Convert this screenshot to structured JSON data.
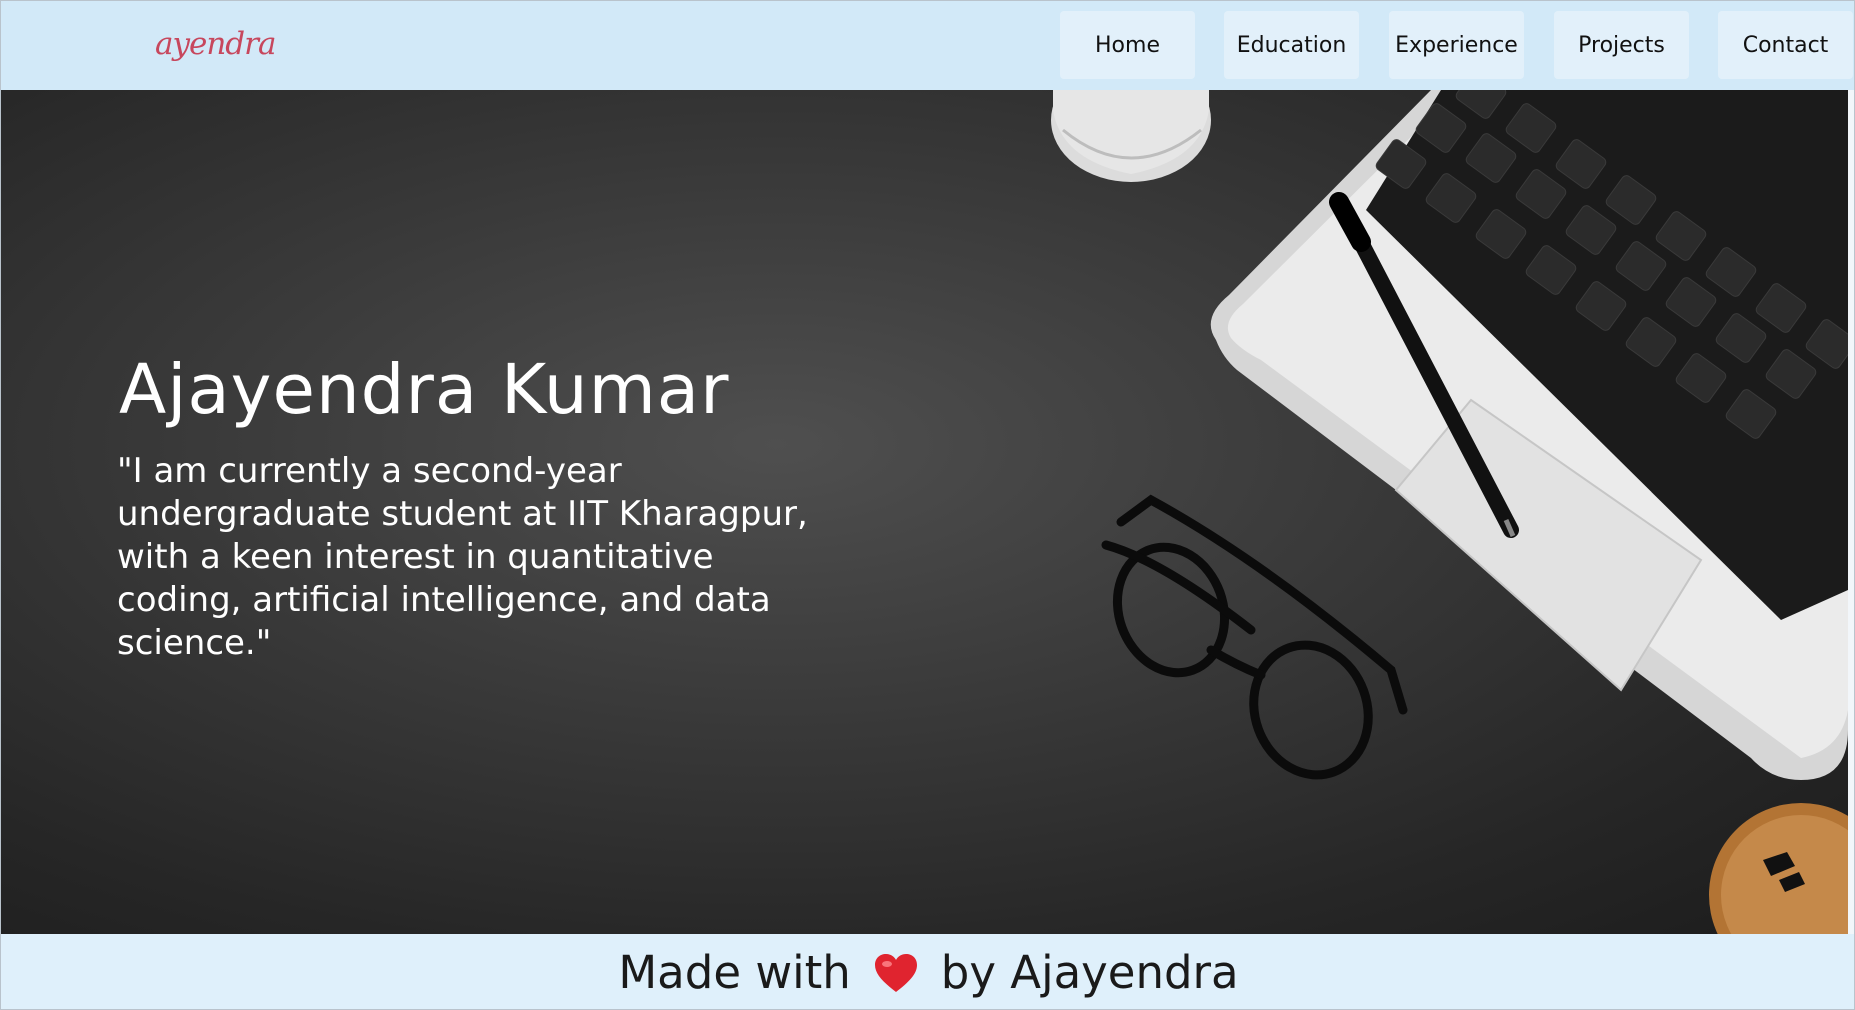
{
  "navbar": {
    "logo_text": "ayendra",
    "items": [
      {
        "label": "Home"
      },
      {
        "label": "Education"
      },
      {
        "label": "Experience"
      },
      {
        "label": "Projects"
      },
      {
        "label": "Contact"
      }
    ]
  },
  "hero": {
    "name": "Ajayendra Kumar",
    "quote": "\"I am currently a second-year undergraduate student at IIT Kharagpur, with a keen interest in quantitative coding, artificial intelligence, and data science.\""
  },
  "footer": {
    "made_with": "Made with",
    "heart_icon": "heart-icon",
    "by": "by Ajayendra"
  },
  "colors": {
    "navbar_bg": "#d2e9f8",
    "nav_button_bg": "#e2f0fa",
    "footer_bg": "#dff0fb",
    "logo": "#c7475d",
    "heart": "#e0242f"
  }
}
